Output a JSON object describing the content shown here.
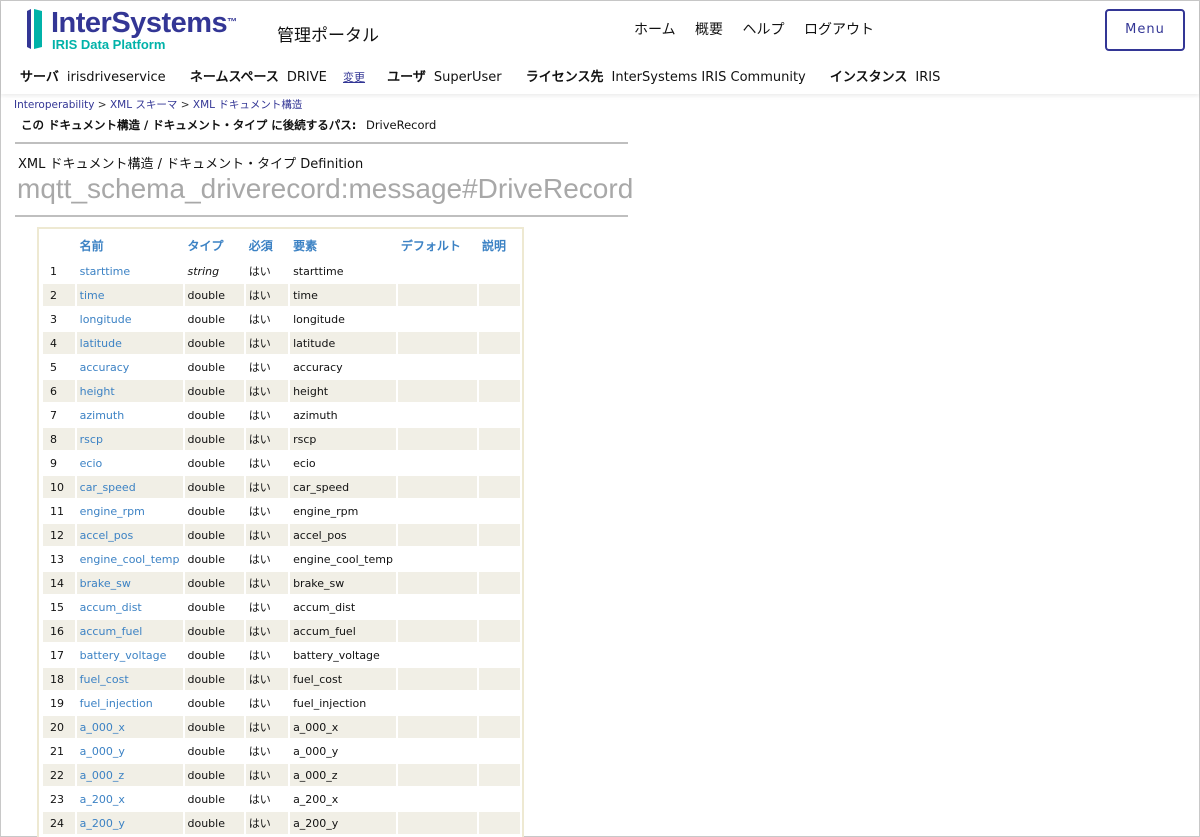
{
  "header": {
    "logo_text": "InterSystems",
    "logo_subtitle": "IRIS Data Platform",
    "portal_title": "管理ポータル",
    "nav": [
      "ホーム",
      "概要",
      "ヘルプ",
      "ログアウト"
    ],
    "menu_button": "Menu"
  },
  "info": {
    "server_label": "サーバ",
    "server": "irisdriveservice",
    "namespace_label": "ネームスペース",
    "namespace": "DRIVE",
    "change_link": "変更",
    "user_label": "ユーザ",
    "user": "SuperUser",
    "license_label": "ライセンス先",
    "license": "InterSystems IRIS Community",
    "instance_label": "インスタンス",
    "instance": "IRIS"
  },
  "breadcrumb": [
    "Interoperability",
    "XML スキーマ",
    "XML ドキュメント構造"
  ],
  "path": {
    "label": "この ドキュメント構造 / ドキュメント・タイプ に後続するパス:",
    "value": "DriveRecord"
  },
  "doc": {
    "label": "XML ドキュメント構造 / ドキュメント・タイプ Definition",
    "name": "mqtt_schema_driverecord:message#DriveRecord"
  },
  "table": {
    "headers": [
      "",
      "名前",
      "タイプ",
      "必須",
      "要素",
      "デフォルト",
      "説明"
    ],
    "rows": [
      {
        "num": "1",
        "name": "starttime",
        "type": "string",
        "req": "はい",
        "elem": "starttime"
      },
      {
        "num": "2",
        "name": "time",
        "type": "double",
        "req": "はい",
        "elem": "time"
      },
      {
        "num": "3",
        "name": "longitude",
        "type": "double",
        "req": "はい",
        "elem": "longitude"
      },
      {
        "num": "4",
        "name": "latitude",
        "type": "double",
        "req": "はい",
        "elem": "latitude"
      },
      {
        "num": "5",
        "name": "accuracy",
        "type": "double",
        "req": "はい",
        "elem": "accuracy"
      },
      {
        "num": "6",
        "name": "height",
        "type": "double",
        "req": "はい",
        "elem": "height"
      },
      {
        "num": "7",
        "name": "azimuth",
        "type": "double",
        "req": "はい",
        "elem": "azimuth"
      },
      {
        "num": "8",
        "name": "rscp",
        "type": "double",
        "req": "はい",
        "elem": "rscp"
      },
      {
        "num": "9",
        "name": "ecio",
        "type": "double",
        "req": "はい",
        "elem": "ecio"
      },
      {
        "num": "10",
        "name": "car_speed",
        "type": "double",
        "req": "はい",
        "elem": "car_speed"
      },
      {
        "num": "11",
        "name": "engine_rpm",
        "type": "double",
        "req": "はい",
        "elem": "engine_rpm"
      },
      {
        "num": "12",
        "name": "accel_pos",
        "type": "double",
        "req": "はい",
        "elem": "accel_pos"
      },
      {
        "num": "13",
        "name": "engine_cool_temp",
        "type": "double",
        "req": "はい",
        "elem": "engine_cool_temp"
      },
      {
        "num": "14",
        "name": "brake_sw",
        "type": "double",
        "req": "はい",
        "elem": "brake_sw"
      },
      {
        "num": "15",
        "name": "accum_dist",
        "type": "double",
        "req": "はい",
        "elem": "accum_dist"
      },
      {
        "num": "16",
        "name": "accum_fuel",
        "type": "double",
        "req": "はい",
        "elem": "accum_fuel"
      },
      {
        "num": "17",
        "name": "battery_voltage",
        "type": "double",
        "req": "はい",
        "elem": "battery_voltage"
      },
      {
        "num": "18",
        "name": "fuel_cost",
        "type": "double",
        "req": "はい",
        "elem": "fuel_cost"
      },
      {
        "num": "19",
        "name": "fuel_injection",
        "type": "double",
        "req": "はい",
        "elem": "fuel_injection"
      },
      {
        "num": "20",
        "name": "a_000_x",
        "type": "double",
        "req": "はい",
        "elem": "a_000_x"
      },
      {
        "num": "21",
        "name": "a_000_y",
        "type": "double",
        "req": "はい",
        "elem": "a_000_y"
      },
      {
        "num": "22",
        "name": "a_000_z",
        "type": "double",
        "req": "はい",
        "elem": "a_000_z"
      },
      {
        "num": "23",
        "name": "a_200_x",
        "type": "double",
        "req": "はい",
        "elem": "a_200_x"
      },
      {
        "num": "24",
        "name": "a_200_y",
        "type": "double",
        "req": "はい",
        "elem": "a_200_y"
      }
    ]
  },
  "colors": {
    "brand": "#333695",
    "accent": "#00b2a9",
    "link": "#3c82c4",
    "alt_row": "#f1efe6"
  }
}
